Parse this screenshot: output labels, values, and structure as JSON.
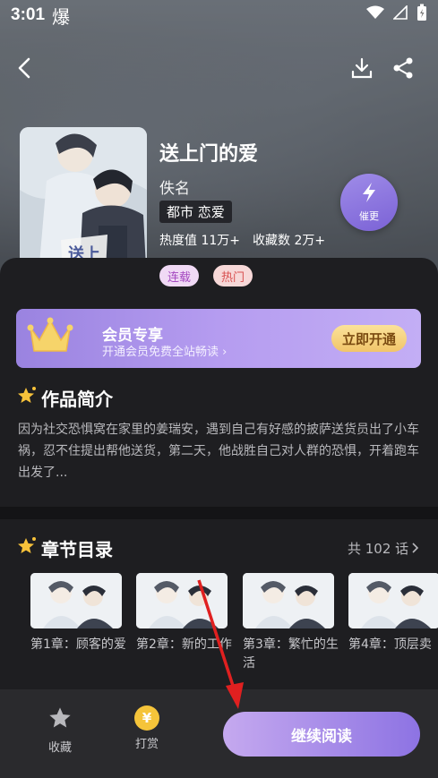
{
  "status_bar": {
    "time": "3:01",
    "burn_glyph": "爆",
    "icons": [
      "wifi-icon",
      "signal-icon",
      "battery-icon"
    ]
  },
  "nav": {
    "icons": [
      "back-arrow-icon",
      "download-icon",
      "share-icon"
    ]
  },
  "book": {
    "title": "送上门的爱",
    "author": "佚名",
    "genre": "都市 恋爱",
    "heat": "热度值 11万+",
    "favorites": "收藏数 2万+",
    "tags": [
      "连载",
      "热门"
    ],
    "urge_label": "催更"
  },
  "vip": {
    "title": "会员专享",
    "subtitle": "开通会员免费全站畅读 ›",
    "button": "立即开通"
  },
  "intro": {
    "heading": "作品简介",
    "text": "因为社交恐惧窝在家里的姜瑞安，遇到自己有好感的披萨送货员出了小车祸，忍不住提出帮他送货，第二天，他战胜自己对人群的恐惧，开着跑车出发了..."
  },
  "chapters": {
    "heading": "章节目录",
    "count": "共 102 话",
    "items": [
      {
        "title": "第1章：顾客的爱"
      },
      {
        "title": "第2章：新的工作"
      },
      {
        "title": "第3章：繁忙的生活"
      },
      {
        "title": "第4章：顶层卖"
      }
    ]
  },
  "bottom_bar": {
    "favorite": "收藏",
    "tip": "打赏",
    "tip_glyph": "¥",
    "read": "继续阅读"
  },
  "colors": {
    "accent": "#8d73e3",
    "vip_gold": "#f1c56a",
    "panel": "#1e1e21",
    "annotation_arrow": "#e02020"
  }
}
